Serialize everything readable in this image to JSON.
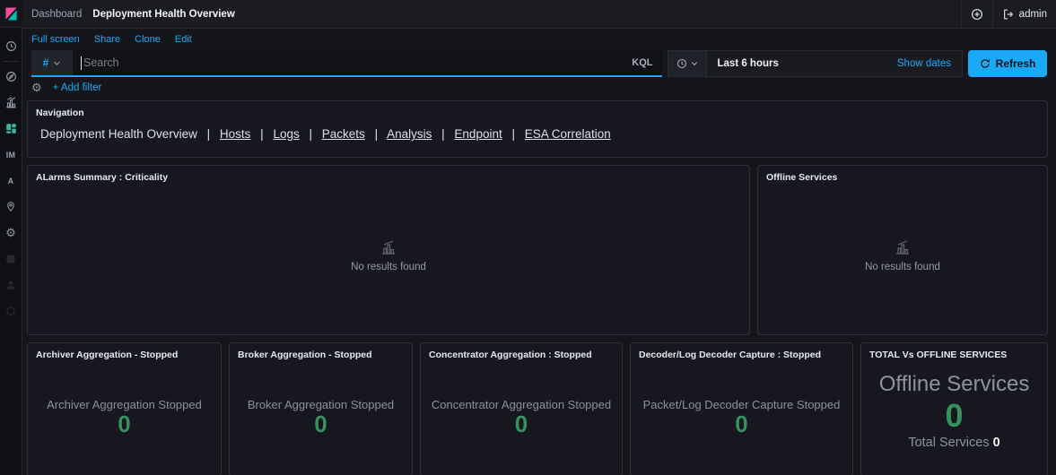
{
  "header": {
    "breadcrumb": "Dashboard",
    "title": "Deployment Health Overview",
    "user": "admin"
  },
  "toolbar": {
    "links": [
      "Full screen",
      "Share",
      "Clone",
      "Edit"
    ]
  },
  "search": {
    "filter_symbol": "#",
    "placeholder": "Search",
    "language_label": "KQL",
    "time_range": "Last 6 hours",
    "show_dates_label": "Show dates",
    "refresh_label": "Refresh",
    "add_filter_label": "+ Add filter"
  },
  "sidebar": {
    "icons": [
      "kibana-logo",
      "recently-viewed-clock",
      "discover-compass",
      "visualize-chart",
      "dashboard-grid",
      "im",
      "a",
      "maps-pin",
      "management-gear"
    ],
    "im_label": "IM",
    "a_label": "A",
    "gear_glyph": "⚙"
  },
  "navigation": {
    "title": "Navigation",
    "current": "Deployment Health Overview",
    "separator": "|",
    "links": [
      "Hosts",
      "Logs",
      "Packets",
      "Analysis",
      "Endpoint",
      "ESA Correlation"
    ]
  },
  "panels": {
    "alarms": {
      "title": "ALarms Summary : Criticality",
      "empty_text": "No results found"
    },
    "offline": {
      "title": "Offline Services",
      "empty_text": "No results found"
    },
    "stats": [
      {
        "title": "Archiver Aggregation - Stopped",
        "label": "Archiver Aggregation Stopped",
        "value": "0"
      },
      {
        "title": "Broker Aggregation - Stopped",
        "label": "Broker Aggregation Stopped",
        "value": "0"
      },
      {
        "title": "Concentrator Aggregation : Stopped",
        "label": "Concentrator Aggregation Stopped",
        "value": "0"
      },
      {
        "title": "Decoder/Log Decoder Capture : Stopped",
        "label": "Packet/Log Decoder Capture Stopped",
        "value": "0"
      }
    ],
    "total": {
      "title": "TOTAL Vs OFFLINE SERVICES",
      "headline": "Offline Services",
      "value": "0",
      "total_label": "Total Services",
      "total_value": "0"
    }
  },
  "colors": {
    "accent_blue": "#1ba9f5",
    "value_green": "#37915e"
  }
}
